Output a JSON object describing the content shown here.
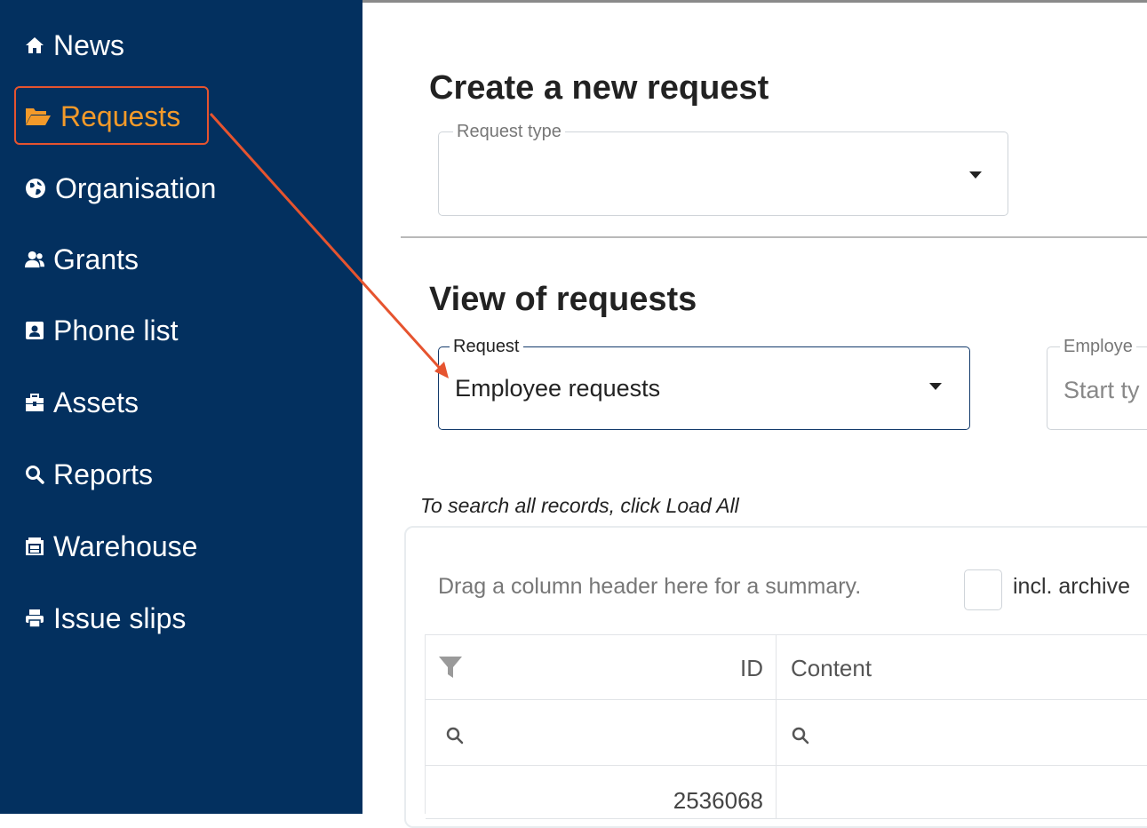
{
  "sidebar": {
    "items": [
      {
        "label": "News",
        "icon": "home-icon",
        "active": false
      },
      {
        "label": "Requests",
        "icon": "folder-open-icon",
        "active": true
      },
      {
        "label": "Organisation",
        "icon": "globe-icon",
        "active": false
      },
      {
        "label": "Grants",
        "icon": "users-icon",
        "active": false
      },
      {
        "label": "Phone list",
        "icon": "address-card-icon",
        "active": false
      },
      {
        "label": "Assets",
        "icon": "toolbox-icon",
        "active": false
      },
      {
        "label": "Reports",
        "icon": "search-icon",
        "active": false
      },
      {
        "label": "Warehouse",
        "icon": "warehouse-icon",
        "active": false
      },
      {
        "label": "Issue slips",
        "icon": "print-icon",
        "active": false
      }
    ]
  },
  "create": {
    "title": "Create a new request",
    "request_type_label": "Request type",
    "request_type_value": ""
  },
  "view": {
    "title": "View of requests",
    "request_label": "Request",
    "request_value": "Employee requests",
    "employee_label": "Employe",
    "employee_placeholder": "Start ty"
  },
  "grid": {
    "hint": "To search all records, click Load All",
    "group_hint": "Drag a column header here for a summary.",
    "archive_label": "incl. archive",
    "columns": [
      "ID",
      "Content"
    ],
    "rows": [
      [
        "2536068",
        ""
      ]
    ]
  },
  "colors": {
    "sidebar_bg": "#03305f",
    "active_item": "#f39a2a",
    "highlight_box": "#e6542f"
  }
}
